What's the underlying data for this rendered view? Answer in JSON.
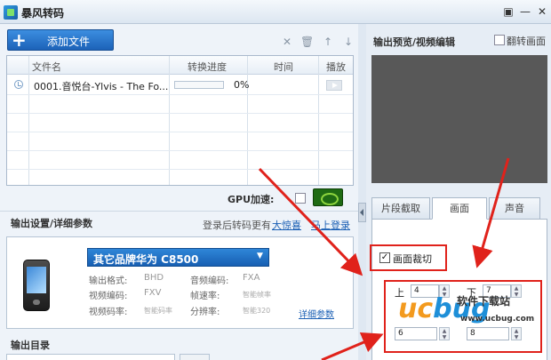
{
  "window": {
    "title": "暴风转码",
    "controls": {
      "menu": "▣",
      "minimize": "—",
      "close": "✕"
    }
  },
  "toolbar": {
    "add_file_label": "添加文件",
    "add_icon": "+",
    "icons": [
      "close-icon",
      "trash-icon",
      "arrow-up-icon",
      "arrow-down-icon"
    ]
  },
  "file_table": {
    "columns": [
      "文件名",
      "转换进度",
      "时间",
      "播放"
    ],
    "rows": [
      {
        "name": "0001.音悦台-Ylvis - The Fo...",
        "progress_text": "0%",
        "progress": 0,
        "time": ""
      }
    ]
  },
  "gpu": {
    "label": "GPU加速:",
    "checked": false
  },
  "settings": {
    "title": "输出设置/详细参数",
    "login_text": "登录后转码更有",
    "surprise_link": "大惊喜",
    "login_link": "马上登录"
  },
  "device": {
    "brand": "其它品牌",
    "model": "华为  C8500",
    "params": [
      {
        "label": "输出格式:",
        "value": "BHD"
      },
      {
        "label": "音频编码:",
        "value": "FXA"
      },
      {
        "label": "视频编码:",
        "value": "FXV"
      },
      {
        "label": "帧速率:",
        "value": "智能帧率"
      },
      {
        "label": "视频码率:",
        "value": "智能码率"
      },
      {
        "label": "分辨率:",
        "value": "智能320"
      }
    ],
    "detail_link": "详细参数"
  },
  "output_dir": {
    "title": "输出目录"
  },
  "preview": {
    "title": "输出预览/视频编辑",
    "flip_label": "翻转画面",
    "flip_checked": false
  },
  "tabs": [
    {
      "label": "片段截取",
      "active": false
    },
    {
      "label": "画面",
      "active": true
    },
    {
      "label": "声音",
      "active": false
    }
  ],
  "crop": {
    "label": "画面裁切",
    "checked": true,
    "check_glyph": "✓",
    "top_label": "上",
    "top_value": "4",
    "bottom_label": "下",
    "bottom_value": "7",
    "left_value": "6",
    "right_value": "8"
  },
  "watermark": {
    "brand_u": "u",
    "brand_c": "c",
    "brand_rest": "bug",
    "subtitle": "软件下载站",
    "url": "www.ucbug.com"
  },
  "colors": {
    "accent_blue": "#1c62b8",
    "annotation_red": "#e0221b",
    "watermark_orange": "#f39a1e",
    "watermark_blue": "#1e8fd8"
  }
}
